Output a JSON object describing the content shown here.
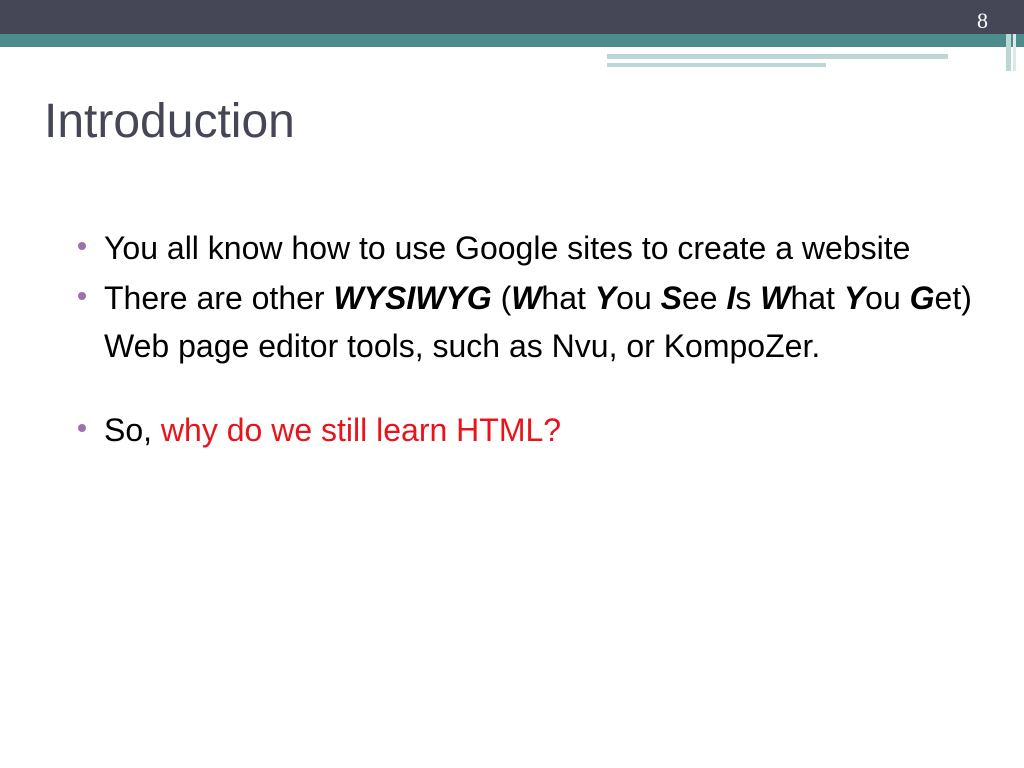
{
  "slide": {
    "number": "8",
    "title": "Introduction",
    "colors": {
      "header_dark": "#454656",
      "header_teal": "#4c8c8c",
      "bullet": "#9c72a8",
      "highlight": "#e8141b"
    },
    "bullets": [
      {
        "text": "You all know how to use Google sites to create a website"
      },
      {
        "parts": {
          "p1": "There are other ",
          "p2": "WYSIWYG",
          "p3": " (",
          "p4": "W",
          "p5": "hat ",
          "p6": "Y",
          "p7": "ou ",
          "p8": "S",
          "p9": "ee ",
          "p10": "I",
          "p11": "s ",
          "p12": "W",
          "p13": "hat ",
          "p14": "Y",
          "p15": "ou ",
          "p16": "G",
          "p17": "et) Web page editor tools, such as Nvu, or KompoZer."
        }
      },
      {
        "parts": {
          "p1": "So, ",
          "p2": "why do we still learn HTML?"
        }
      }
    ]
  }
}
